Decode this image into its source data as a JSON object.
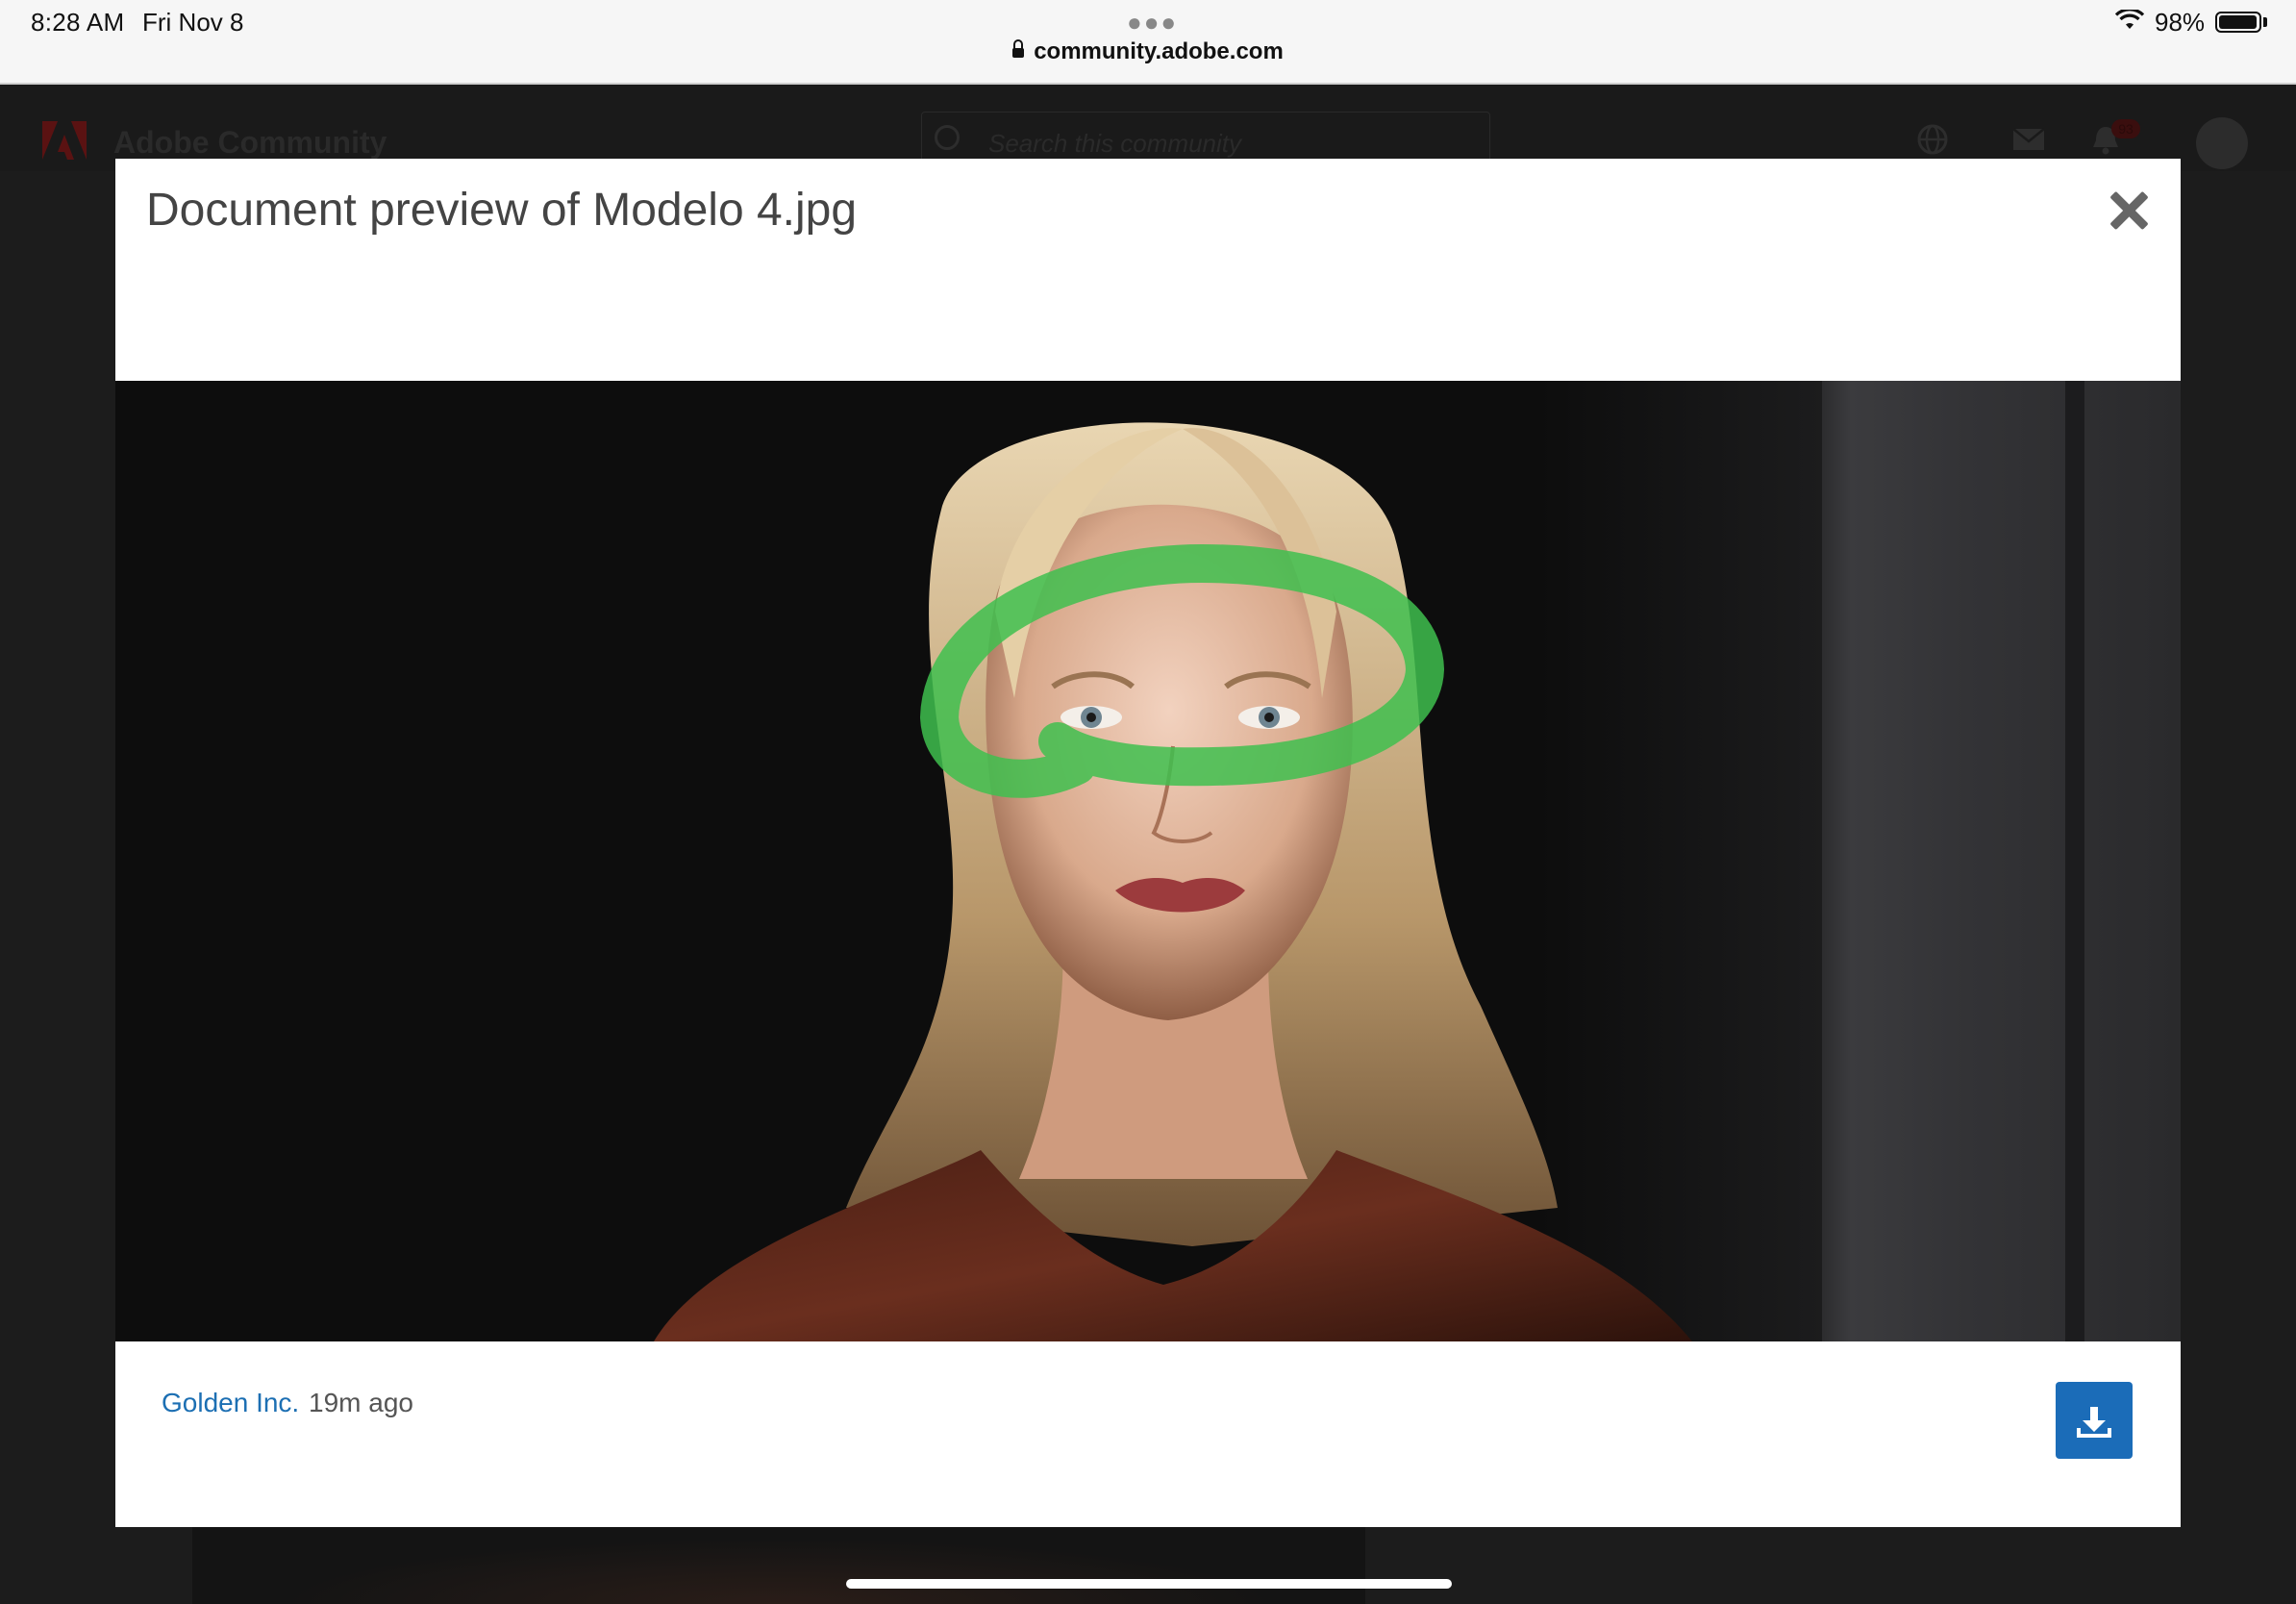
{
  "status_bar": {
    "time": "8:28 AM",
    "date": "Fri Nov 8",
    "url": "community.adobe.com",
    "battery": "98%",
    "battery_level": 0.98
  },
  "background_page": {
    "site_title": "Adobe Community",
    "search_placeholder": "Search this community",
    "notification_count": "93"
  },
  "modal": {
    "title": "Document preview of Modelo 4.jpg",
    "author": "Golden Inc.",
    "posted": "19m ago"
  },
  "colors": {
    "link": "#1c6fb3",
    "download_button": "#1b6cb8",
    "annotation_stroke": "#3fbf4f"
  },
  "icons": [
    "lock-icon",
    "wifi-icon",
    "battery-icon",
    "adobe-logo-icon",
    "search-icon",
    "globe-icon",
    "mail-icon",
    "bell-icon",
    "close-icon",
    "download-icon"
  ]
}
